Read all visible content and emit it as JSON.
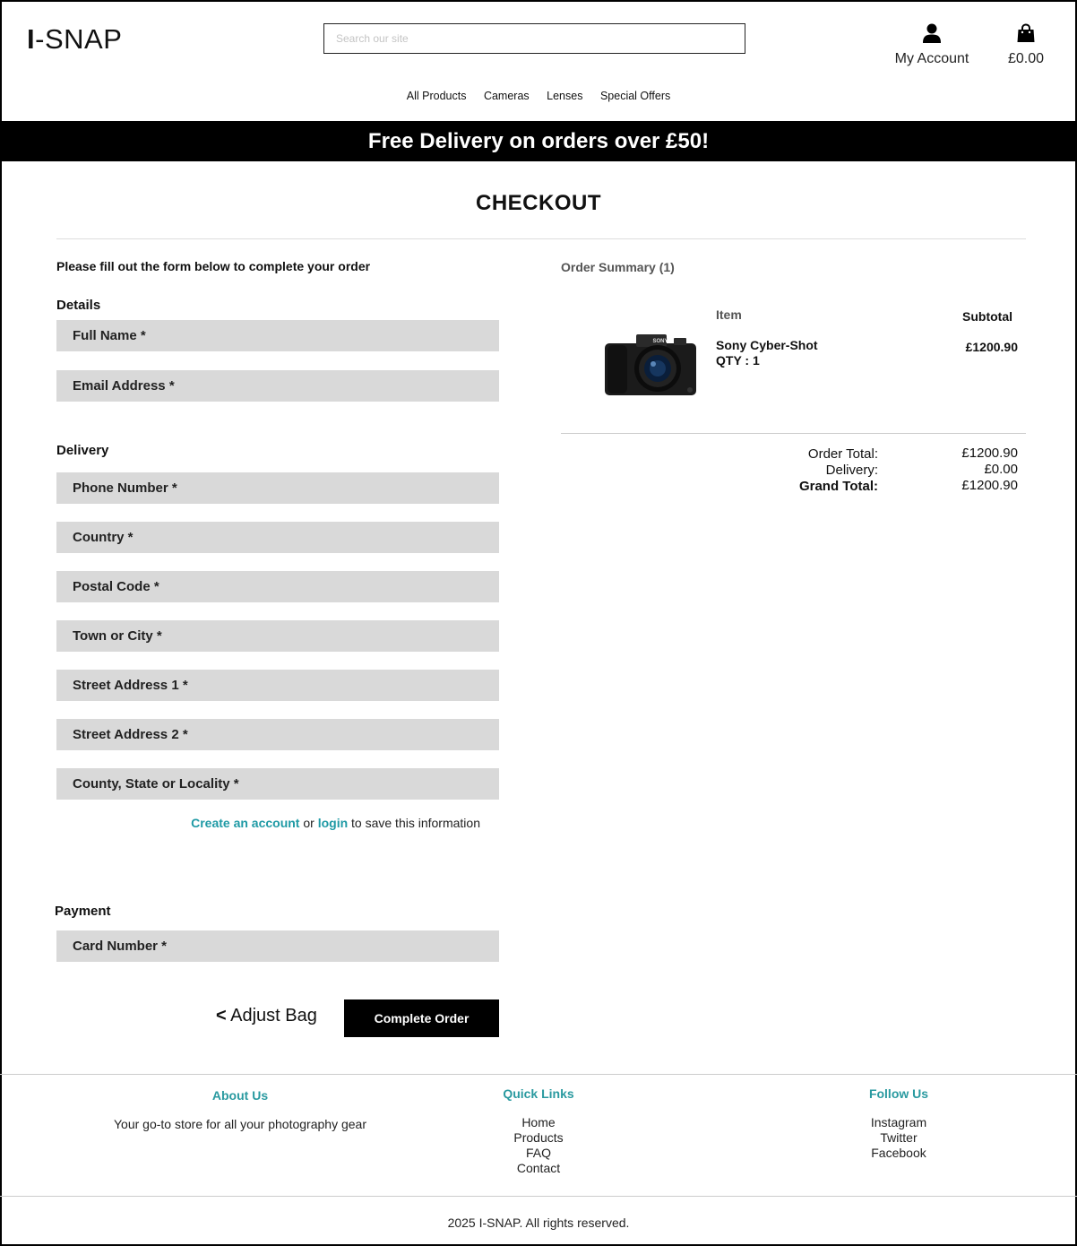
{
  "header": {
    "logo_first": "I",
    "logo_rest": "-SNAP",
    "search_placeholder": "Search our site",
    "account_label": "My Account",
    "bag_total": "£0.00",
    "nav": [
      "All Products",
      "Cameras",
      "Lenses",
      "Special Offers"
    ]
  },
  "banner": {
    "text": "Free Delivery on orders over £50!"
  },
  "checkout": {
    "title": "CHECKOUT",
    "intro": "Please fill out the form below to complete your order",
    "details_label": "Details",
    "delivery_label": "Delivery",
    "payment_label": "Payment",
    "fields": {
      "full_name": "Full Name *",
      "email": "Email Address *",
      "phone": "Phone Number *",
      "country": "Country *",
      "postcode": "Postal Code *",
      "town": "Town or City *",
      "street1": "Street Address 1 *",
      "street2": "Street Address 2 *",
      "county": "County, State or Locality *",
      "card": "Card Number *"
    },
    "save_note": {
      "create": "Create an account",
      "or": " or ",
      "login": "login",
      "rest": " to save this information"
    },
    "adjust_arrow": "<",
    "adjust_label": " Adjust Bag",
    "complete_label": "Complete Order"
  },
  "summary": {
    "title": "Order Summary (1)",
    "col_item": "Item",
    "col_subtotal": "Subtotal",
    "product": {
      "name": "Sony Cyber-Shot",
      "qty": "QTY : 1",
      "price": "£1200.90",
      "brand_on_image": "SONY"
    },
    "totals": {
      "order_total_label": "Order Total:",
      "order_total": "£1200.90",
      "delivery_label": "Delivery:",
      "delivery": "£0.00",
      "grand_total_label": "Grand Total:",
      "grand_total": "£1200.90"
    }
  },
  "footer": {
    "about_title": "About Us",
    "about_text": "Your go-to store for all your photography gear",
    "quick_title": "Quick Links",
    "quick_links": [
      "Home",
      "Products",
      "FAQ",
      "Contact"
    ],
    "follow_title": "Follow Us",
    "follow_links": [
      "Instagram",
      "Twitter",
      "Facebook"
    ],
    "copyright": "2025 I-SNAP. All rights reserved."
  },
  "colors": {
    "accent": "#1f9aa5",
    "footer_heading": "#2a9aa0",
    "field_bg": "#d9d9d9",
    "banner_bg": "#000000"
  }
}
